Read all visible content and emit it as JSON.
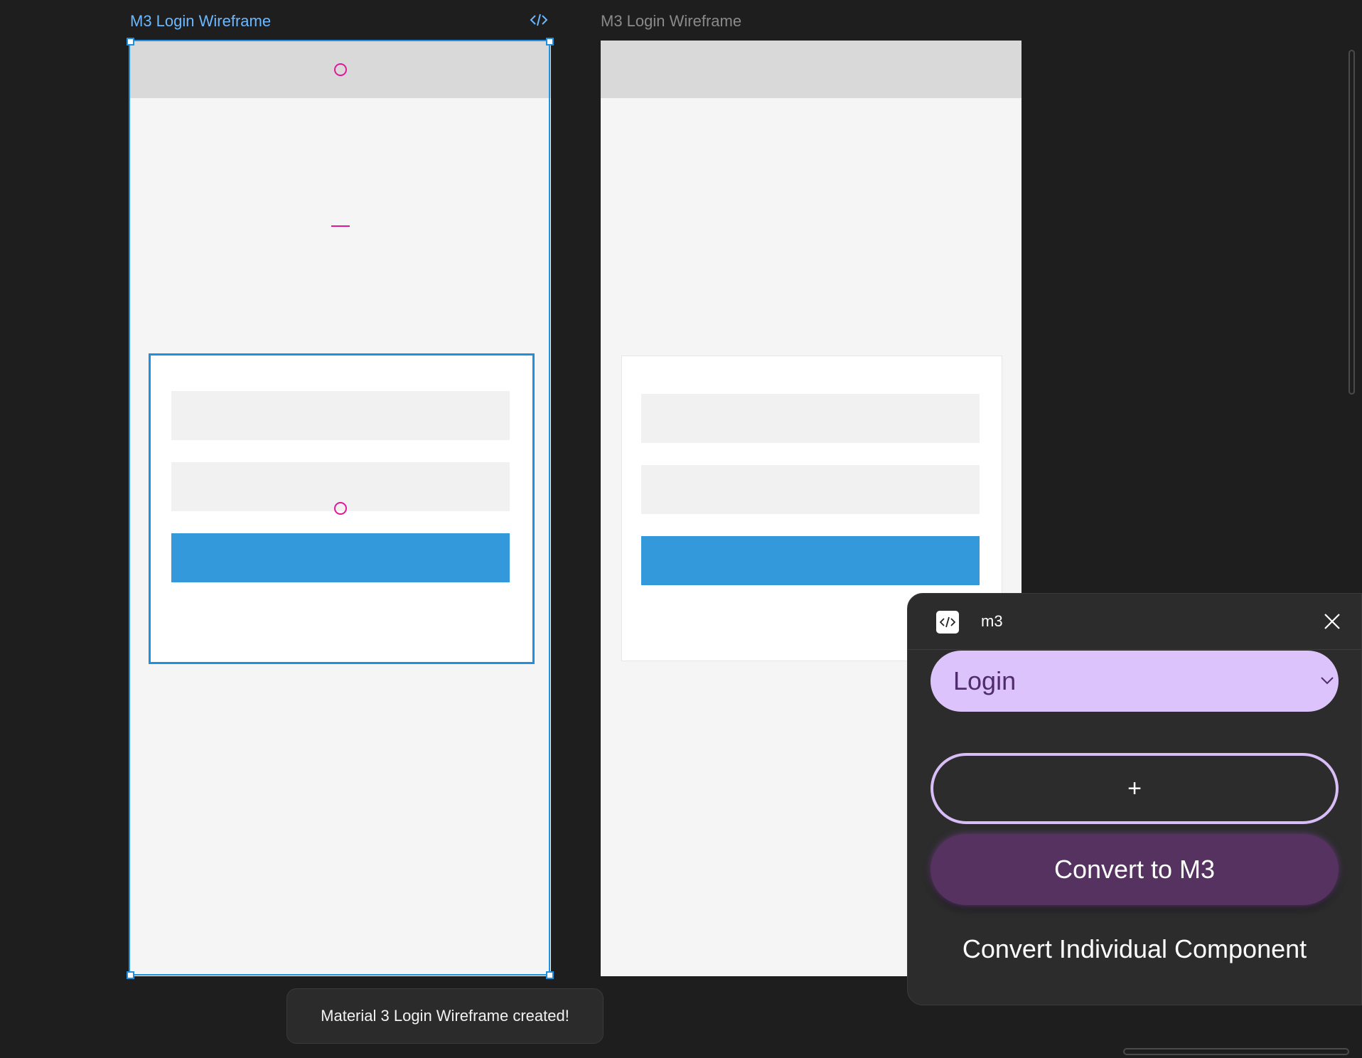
{
  "canvas": {
    "frames": [
      {
        "title": "M3 Login Wireframe",
        "selected": true
      },
      {
        "title": "M3 Login Wireframe",
        "selected": false
      }
    ]
  },
  "toast": {
    "message": "Material 3 Login Wireframe created!"
  },
  "plugin": {
    "title": "m3",
    "select": {
      "value": "Login"
    },
    "add_label": "+",
    "convert_label": "Convert to M3",
    "convert_individual_label": "Convert Individual Component"
  },
  "colors": {
    "selection": "#1f8fe0",
    "primary_button": "#3399db",
    "select_fill": "#dcc3fb",
    "convert_fill": "#55325f",
    "marker": "#e0199a"
  }
}
